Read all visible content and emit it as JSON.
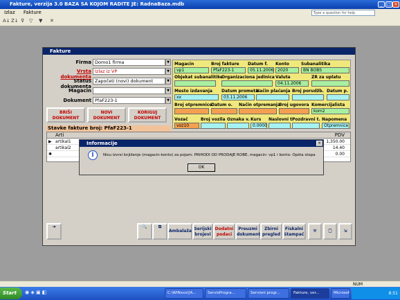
{
  "app": {
    "title": "Fakture, verzija 3.0   BAZA SA KOJOM RADITE JE: RadnaBaza.mdb"
  },
  "menu": {
    "items": [
      "Izlaz",
      "Fakture"
    ],
    "help_placeholder": "Type a question for help"
  },
  "form": {
    "title": "Fakture",
    "labels": {
      "firma": "Firma",
      "vrsta": "Vrsta dokumenta",
      "status": "Status dokumenta",
      "magacin": "Magacin",
      "dokument": "Dokument"
    },
    "values": {
      "firma": "Domo1 firma",
      "vrsta": "Izlaz iz VP",
      "status": "Započeti (novi) dokument",
      "magacin": "",
      "dokument": "PfaF223-1"
    },
    "buttons": {
      "brisi": "BRIŠI DOKUMENT",
      "novi": "NOVI DOKUMENT",
      "koriguj": "KORIGUJ DOKUMENT"
    },
    "header": {
      "labels": {
        "magacin": "Magacin",
        "broj_fakture": "Broj fakture",
        "datum_f": "Datum f.",
        "konto": "Konto",
        "subanalitika": "Subanalitika",
        "objekat": "Objekat subanalitike",
        "org": "Organizaciona jedinica",
        "valuta": "Valuta",
        "zr": "ZR za uplatu",
        "mesto": "Mesto izdavanja",
        "datum_prometa": "Datum prometa",
        "nacin_placanja": "Način plaćanja",
        "broj_porudz": "Broj porudžb.",
        "datum_p": "Datum p.",
        "broj_otpremnice": "Broj otpremnice",
        "datum_o": "Datum o.",
        "nacin_otpremanja": "Način otpremanja",
        "broj_ugovora": "Broj ugovora",
        "komercijalista": "Komercijalista",
        "vozac": "Vozač",
        "broj_vozila": "Broj vozila",
        "oznaka_v": "Oznaka v.",
        "kurs": "Kurs",
        "naslovni": "Naslovni t.",
        "pozdravni": "Pozdravni t.",
        "napomena": "Napomena"
      },
      "values": {
        "magacin": "vp1",
        "broj_fakture": "PfaF223-1",
        "datum_f": "05.11.2006",
        "konto": "2020",
        "subanalitika": "BN BOBS",
        "valuta": "04.11.2006",
        "mesto": "xx",
        "datum_prometa": "03.11.2006",
        "komercijalista": "kom2",
        "vozac": "voz10",
        "kurs": "0.0000",
        "napomena": "Otpremnice"
      }
    },
    "stavke_label": "Stavke fakture broj: PfaF223-1",
    "grid": {
      "col1": "Arti",
      "col_pdv": "PDV",
      "rows": [
        {
          "name": "artikal1",
          "pdv": "1,350.00"
        },
        {
          "name": "artikal2",
          "pdv": "14.40"
        },
        {
          "name": "",
          "pdv": "0.00"
        }
      ]
    },
    "bottom_buttons": {
      "ambalaza": "Ambalaža",
      "serijski": "Serijski brojevi",
      "dodatni": "Dodatni podaci",
      "preuzmi": "Preuzmi dokument",
      "zbirni": "Zbirni pregled",
      "fiskalni": "Fiskalni štampač"
    }
  },
  "dialog": {
    "title": "Informacije",
    "message": "Nisu izvrsi knjiženje (magacin-konto) za pojam: PRIHODI OD PRODAJE ROBE, magacin: vp1 i konto: Opšta stopa",
    "ok": "OK"
  },
  "status": {
    "text": "NUM"
  },
  "taskbar": {
    "start": "Start",
    "tasks": [
      "C:\\WINxxx\\[A...",
      "ServisProgra...",
      "Servisni progr...",
      "ServisProgra...",
      "Fakture, ver...",
      "Microsoft Acc..."
    ],
    "clock": "8:51"
  }
}
